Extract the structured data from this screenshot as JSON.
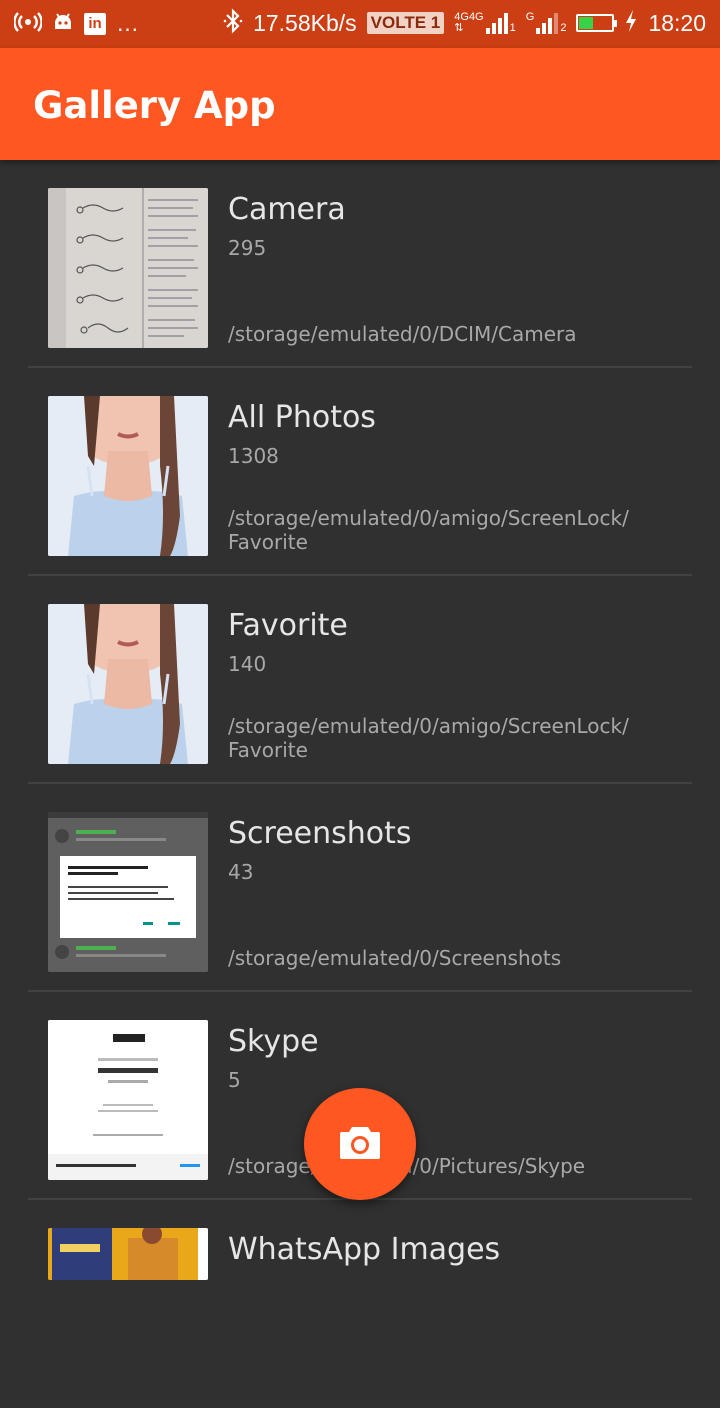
{
  "status_bar": {
    "speed": "17.58Kb/s",
    "volte": "VOLTE 1",
    "net1": "4G",
    "net2": "4G",
    "net3": "G",
    "sim1": "1",
    "sim2": "2",
    "time": "18:20",
    "overflow": "…",
    "linkedin": "in"
  },
  "app_bar": {
    "title": "Gallery App"
  },
  "albums": [
    {
      "name": "Camera",
      "count": "295",
      "path": "/storage/emulated/0/DCIM/Camera"
    },
    {
      "name": "All Photos",
      "count": "1308",
      "path": "/storage/emulated/0/amigo/ScreenLock/\nFavorite"
    },
    {
      "name": "Favorite",
      "count": "140",
      "path": "/storage/emulated/0/amigo/ScreenLock/\nFavorite"
    },
    {
      "name": "Screenshots",
      "count": "43",
      "path": "/storage/emulated/0/Screenshots"
    },
    {
      "name": "Skype",
      "count": "5",
      "path": "/storage/emulated/0/Pictures/Skype"
    },
    {
      "name": "WhatsApp Images",
      "count": "",
      "path": ""
    }
  ],
  "fab": {
    "icon": "camera-icon"
  }
}
